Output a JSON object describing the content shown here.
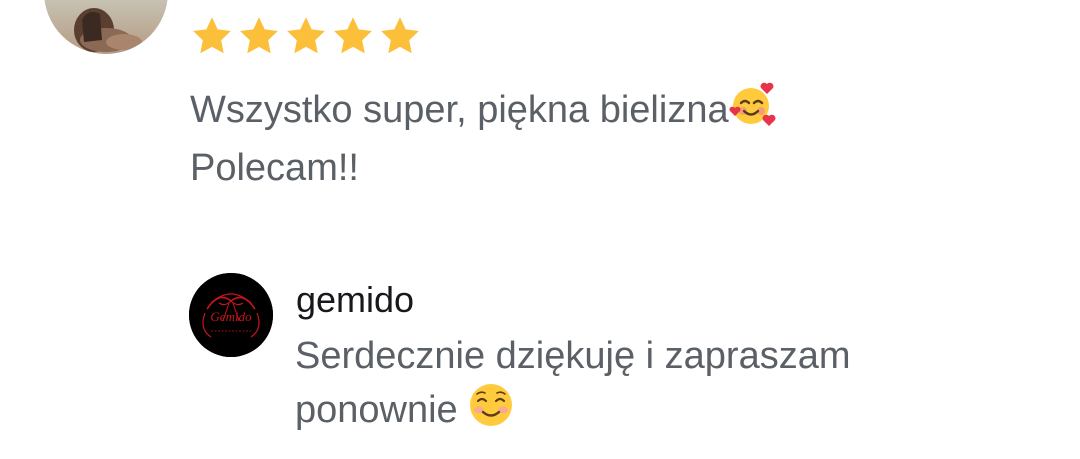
{
  "review": {
    "rating": 5,
    "rating_max": 5,
    "star_color": "#FBBF3A",
    "text_line1": "Wszystko super, piękna bielizna",
    "text_line2": "Polecam!!",
    "emoji1": "smiling-face-with-hearts-icon"
  },
  "reply": {
    "author": "gemido",
    "text_line1": "Serdecznie dziękuję i zapraszam",
    "text_line2": "ponownie ",
    "emoji": "smiling-face-icon",
    "logo_text": "Gemido",
    "logo_color": "#C8141B"
  }
}
